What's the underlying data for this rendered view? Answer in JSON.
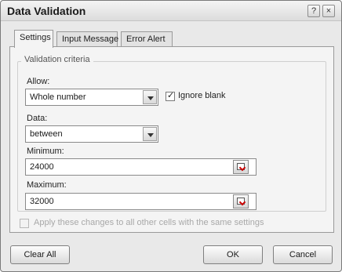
{
  "window": {
    "title": "Data Validation",
    "help_glyph": "?",
    "close_glyph": "×"
  },
  "tabs": [
    {
      "label": "Settings",
      "active": true
    },
    {
      "label": "Input Message",
      "active": false
    },
    {
      "label": "Error Alert",
      "active": false
    }
  ],
  "criteria": {
    "legend": "Validation criteria",
    "allow_label": "Allow:",
    "allow_value": "Whole number",
    "ignore_blank_label": "Ignore blank",
    "ignore_blank_checked": true,
    "data_label": "Data:",
    "data_value": "between",
    "minimum_label": "Minimum:",
    "minimum_value": "24000",
    "maximum_label": "Maximum:",
    "maximum_value": "32000"
  },
  "apply_all": {
    "label": "Apply these changes to all other cells with the same settings",
    "checked": false,
    "enabled": false
  },
  "buttons": {
    "clear_all": "Clear All",
    "ok": "OK",
    "cancel": "Cancel"
  },
  "icons": {
    "help": "help-icon",
    "close": "close-icon",
    "dropdown": "chevron-down-icon",
    "collapse_dialog": "collapse-dialog-icon"
  }
}
